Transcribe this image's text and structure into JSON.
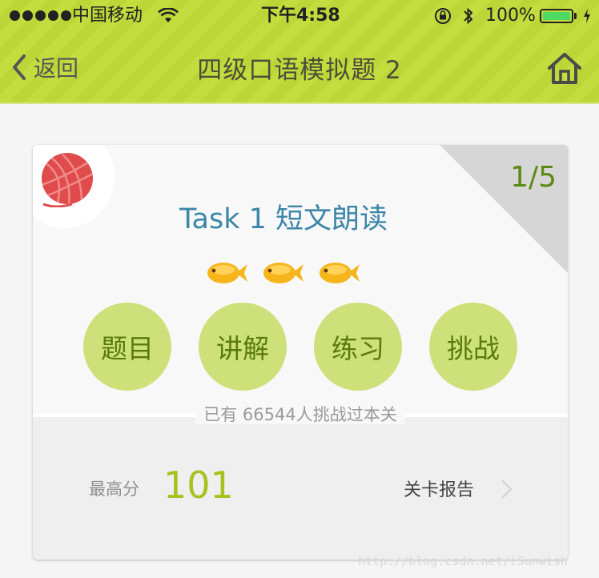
{
  "status_bar": {
    "carrier": "中国移动",
    "time": "下午4:58",
    "battery": "100%",
    "battery_level": 1.0,
    "battery_color": "#4cd964"
  },
  "nav": {
    "back_label": "返回",
    "title": "四级口语模拟题 2",
    "home_icon": "home-icon"
  },
  "card": {
    "page_indicator": "1/5",
    "task_title": "Task 1 短文朗读",
    "fish_count": 3,
    "actions": [
      {
        "label": "题目"
      },
      {
        "label": "讲解"
      },
      {
        "label": "练习"
      },
      {
        "label": "挑战"
      }
    ],
    "challenge_text": "已有 66544人挑战过本关",
    "best_score_label": "最高分",
    "best_score": "101",
    "report_label": "关卡报告"
  },
  "watermark": "http://blog.csdn.net/iSunwish",
  "colors": {
    "header_green": "#c3dc3e",
    "circle_bg": "#cde07a",
    "circle_text": "#5a7a0e",
    "title_blue": "#3c86a8",
    "score_green": "#a6c21c",
    "yarn_red": "#e04b4b"
  }
}
